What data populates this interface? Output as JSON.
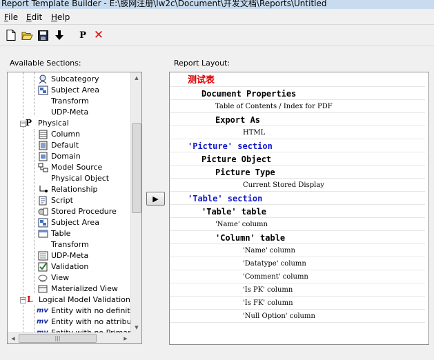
{
  "window": {
    "title": "Report Template Builder - E:\\肢网注册\\lw2c\\Document\\开发文档\\Reports\\Untitled"
  },
  "menu": [
    {
      "label": "File",
      "accel": "F",
      "rest": "ile"
    },
    {
      "label": "Edit",
      "accel": "E",
      "rest": "dit"
    },
    {
      "label": "Help",
      "accel": "H",
      "rest": "elp"
    }
  ],
  "toolbar": {
    "p_label": "P",
    "delete_label": "✕"
  },
  "left_panel": {
    "label": "Available Sections:",
    "tree": [
      {
        "label": "Subcategory",
        "icon": "subcategory-icon"
      },
      {
        "label": "Subject Area",
        "icon": "subject-area-icon"
      },
      {
        "label": "Transform",
        "icon": "none"
      },
      {
        "label": "UDP-Meta",
        "icon": "none"
      },
      {
        "label": "Physical",
        "icon": "physical-icon"
      },
      {
        "label": "Column",
        "icon": "column-icon"
      },
      {
        "label": "Default",
        "icon": "default-icon"
      },
      {
        "label": "Domain",
        "icon": "domain-icon"
      },
      {
        "label": "Model Source",
        "icon": "model-source-icon"
      },
      {
        "label": "Physical Object",
        "icon": "none"
      },
      {
        "label": "Relationship",
        "icon": "relationship-icon"
      },
      {
        "label": "Script",
        "icon": "script-icon"
      },
      {
        "label": "Stored Procedure",
        "icon": "stored-procedure-icon"
      },
      {
        "label": "Subject Area",
        "icon": "subject-area-icon"
      },
      {
        "label": "Table",
        "icon": "table-icon"
      },
      {
        "label": "Transform",
        "icon": "none"
      },
      {
        "label": "UDP-Meta",
        "icon": "udp-meta-icon"
      },
      {
        "label": "Validation",
        "icon": "validation-icon"
      },
      {
        "label": "View",
        "icon": "view-icon"
      },
      {
        "label": "Materialized View",
        "icon": "materialized-view-icon"
      },
      {
        "label": "Logical Model Validation",
        "icon": "logical-icon"
      },
      {
        "label": "Entity with no definition",
        "icon": "mv-icon"
      },
      {
        "label": "Entity with no attributes",
        "icon": "mv-icon"
      },
      {
        "label": "Entity with no Primary Key",
        "icon": "mv-icon"
      }
    ],
    "physical_letter": "P",
    "logical_letter": "L",
    "mv_text": "mv"
  },
  "right_panel": {
    "label": "Report Layout:",
    "rows": [
      {
        "text": "测试表",
        "style": "red",
        "indent": 0
      },
      {
        "text": "Document Properties",
        "style": "bold",
        "indent": 1
      },
      {
        "text": "Table of Contents / Index for PDF",
        "style": "small",
        "indent": 2
      },
      {
        "text": "Export As",
        "style": "bold",
        "indent": 2
      },
      {
        "text": "HTML",
        "style": "small",
        "indent": 3
      },
      {
        "text": "'Picture' section",
        "style": "blue",
        "indent": 0
      },
      {
        "text": "Picture Object",
        "style": "bold",
        "indent": 1
      },
      {
        "text": "Picture Type",
        "style": "bold",
        "indent": 2
      },
      {
        "text": "Current Stored Display",
        "style": "small",
        "indent": 3
      },
      {
        "text": "'Table' section",
        "style": "blue",
        "indent": 0
      },
      {
        "text": "'Table' table",
        "style": "bold",
        "indent": 1
      },
      {
        "text": "'Name' column",
        "style": "small",
        "indent": 2
      },
      {
        "text": "'Column' table",
        "style": "bold",
        "indent": 2
      },
      {
        "text": "'Name' column",
        "style": "small",
        "indent": 3
      },
      {
        "text": "'Datatype' column",
        "style": "small",
        "indent": 3
      },
      {
        "text": "'Comment' column",
        "style": "small",
        "indent": 3
      },
      {
        "text": "'Is PK' column",
        "style": "small",
        "indent": 3
      },
      {
        "text": "'Is FK' column",
        "style": "small",
        "indent": 3
      },
      {
        "text": "'Null Option' column",
        "style": "small",
        "indent": 3
      }
    ]
  },
  "add_button": {
    "label": "▶"
  },
  "scroll": {
    "grip": "|||"
  }
}
